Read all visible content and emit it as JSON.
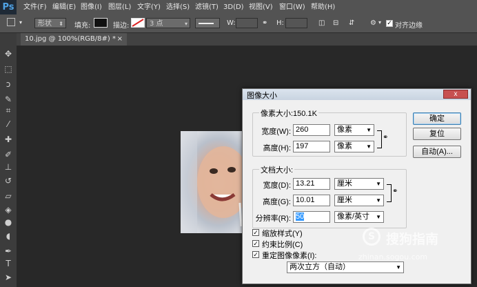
{
  "app": {
    "logo": "Ps"
  },
  "menu": [
    "文件(F)",
    "编辑(E)",
    "图像(I)",
    "图层(L)",
    "文字(Y)",
    "选择(S)",
    "滤镜(T)",
    "3D(D)",
    "视图(V)",
    "窗口(W)",
    "帮助(H)"
  ],
  "options": {
    "shape_mode": "形状",
    "fill_label": "填充:",
    "stroke_label": "描边:",
    "stroke_width": "3 点",
    "w_label": "W:",
    "h_label": "H:",
    "align_edges_label": "对齐边缘",
    "align_edges_checked": true
  },
  "tab": {
    "title": "10.jpg @ 100%(RGB/8#) *",
    "close": "×"
  },
  "dialog": {
    "title": "图像大小",
    "close": "x",
    "pixel_dims": {
      "legend": "像素大小:150.1K",
      "width_label": "宽度(W):",
      "width_value": "260",
      "width_unit": "像素",
      "height_label": "高度(H):",
      "height_value": "197",
      "height_unit": "像素"
    },
    "doc_size": {
      "legend": "文档大小:",
      "width_label": "宽度(D):",
      "width_value": "13.21",
      "width_unit": "厘米",
      "height_label": "高度(G):",
      "height_value": "10.01",
      "height_unit": "厘米",
      "res_label": "分辨率(R):",
      "res_value": "50",
      "res_unit": "像素/英寸"
    },
    "buttons": {
      "ok": "确定",
      "reset": "复位",
      "auto": "自动(A)..."
    },
    "checks": [
      {
        "label": "缩放样式(Y)",
        "checked": true
      },
      {
        "label": "约束比例(C)",
        "checked": true
      },
      {
        "label": "重定图像像素(I):",
        "checked": true
      }
    ],
    "resample_method": "两次立方（自动）"
  },
  "watermark": {
    "main": "搜狗指南",
    "sub": "zhinan.sogou.com"
  }
}
